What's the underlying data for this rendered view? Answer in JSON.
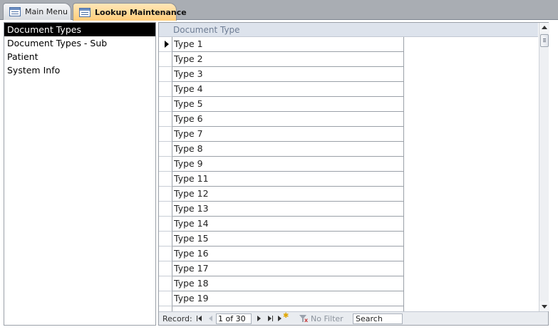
{
  "tabs": [
    {
      "label": "Main Menu",
      "active": false
    },
    {
      "label": "Lookup Maintenance",
      "active": true
    }
  ],
  "lookup_list": {
    "items": [
      {
        "label": "Document Types",
        "selected": true
      },
      {
        "label": "Document Types - Sub",
        "selected": false
      },
      {
        "label": "Patient",
        "selected": false
      },
      {
        "label": "System Info",
        "selected": false
      }
    ]
  },
  "datasheet": {
    "column_header": "Document Type",
    "rows": [
      "Type 1",
      "Type 2",
      "Type 3",
      "Type 4",
      "Type 5",
      "Type 6",
      "Type 7",
      "Type 8",
      "Type 9",
      "Type 11",
      "Type 12",
      "Type 13",
      "Type 14",
      "Type 15",
      "Type 16",
      "Type 17",
      "Type 18",
      "Type 19",
      ""
    ],
    "current_row": 0
  },
  "navigation": {
    "record_label": "Record:",
    "position": "1 of 30",
    "filter_label": "No Filter",
    "search_value": "Search"
  },
  "colors": {
    "selected_bg": "#000000",
    "active_tab": "#ffcd7a",
    "header_bg": "#dde3ec"
  }
}
